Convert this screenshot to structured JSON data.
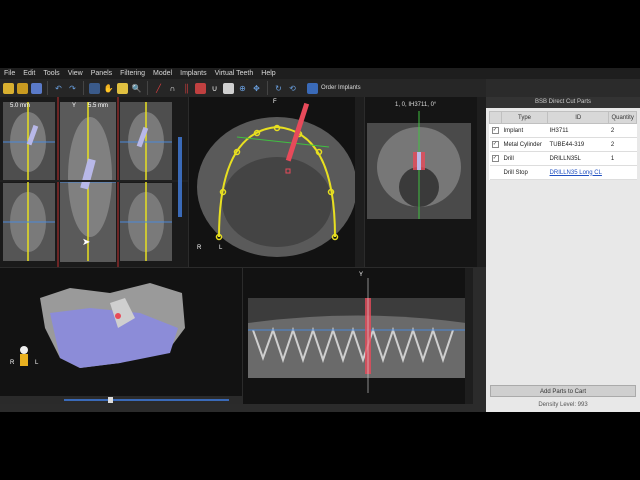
{
  "menu": [
    "File",
    "Edit",
    "Tools",
    "View",
    "Panels",
    "Filtering",
    "Model",
    "Implants",
    "Virtual Teeth",
    "Help"
  ],
  "toolbar": {
    "icons": [
      "open-folder-icon",
      "folder-icon",
      "save-icon",
      "undo-icon",
      "redo-icon",
      "grid-icon",
      "hand-icon",
      "measure-icon",
      "zoom-icon",
      "nerve-icon",
      "tooth-icon",
      "implant-icon",
      "crown-icon",
      "arch-icon",
      "pan-icon",
      "zoom-in-icon",
      "move-icon",
      "rotate-icon",
      "reset-icon"
    ],
    "order_label": "Order Implants"
  },
  "views": {
    "cross_sections": {
      "label_mm_1": "5.0 mm",
      "label_y": "Y",
      "label_mm_2": "5.5 mm"
    },
    "axial": {
      "label_top": "F",
      "label_r": "R",
      "label_l": "L"
    },
    "implant_view": {
      "label": "1, 0, IH3711, 0°"
    },
    "pano": {
      "label_y": "Y"
    },
    "model3d": {
      "label_r": "R",
      "label_l": "L"
    }
  },
  "side_panel": {
    "title": "BSB Direct Cut Parts",
    "headers": [
      "Type",
      "ID",
      "Quantity"
    ],
    "rows": [
      {
        "checked": "✓",
        "type": "Implant",
        "id": "IH3711",
        "qty": "2"
      },
      {
        "checked": "✓",
        "type": "Metal Cylinder",
        "id": "TUBE44-319",
        "qty": "2"
      },
      {
        "checked": "✓",
        "type": "Drill",
        "id": "DRILLN35L",
        "qty": "1"
      },
      {
        "checked": "",
        "type": "Drill Stop",
        "id": "DRILLN35 Long CL",
        "qty": ""
      }
    ],
    "cart_button": "Add Parts to Cart",
    "density": "Density Level: 993"
  },
  "colors": {
    "bg": "#2b2b2b",
    "arch": "#e8e020",
    "implant": "#e84a5a",
    "bone": "#8c8cd8",
    "accent": "#4a88d8"
  }
}
